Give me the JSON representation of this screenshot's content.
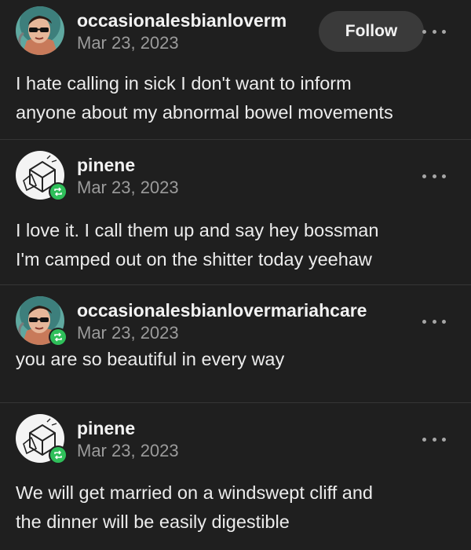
{
  "posts": [
    {
      "username": "occasionalesbianloverm",
      "date": "Mar 23, 2023",
      "follow_label": "Follow",
      "avatar": "cartoon-person-avatar",
      "reblog": false,
      "text": "I hate calling in sick I don't want to inform\nanyone about my abnormal bowel movements"
    },
    {
      "username": "pinene",
      "date": "Mar 23, 2023",
      "avatar": "cube-drawing-avatar",
      "reblog": true,
      "text": "I love it. I call them up and say hey bossman\nI'm camped out on the shitter today yeehaw"
    },
    {
      "username": "occasionalesbianlovermariahcare",
      "date": "Mar 23, 2023",
      "avatar": "cartoon-person-avatar",
      "reblog": true,
      "text": "you are so beautiful in every way"
    },
    {
      "username": "pinene",
      "date": "Mar 23, 2023",
      "avatar": "cube-drawing-avatar",
      "reblog": true,
      "text": "We will get married on a windswept cliff and\nthe dinner will be easily digestible"
    }
  ],
  "colors": {
    "background": "#1f1f1f",
    "text": "#ececec",
    "muted": "#9b9b9b",
    "reblog_green": "#2fbf5a",
    "follow_bg": "#3a3a3a"
  },
  "icons": {
    "more": "more-options-icon",
    "reblog": "reblog-icon"
  }
}
